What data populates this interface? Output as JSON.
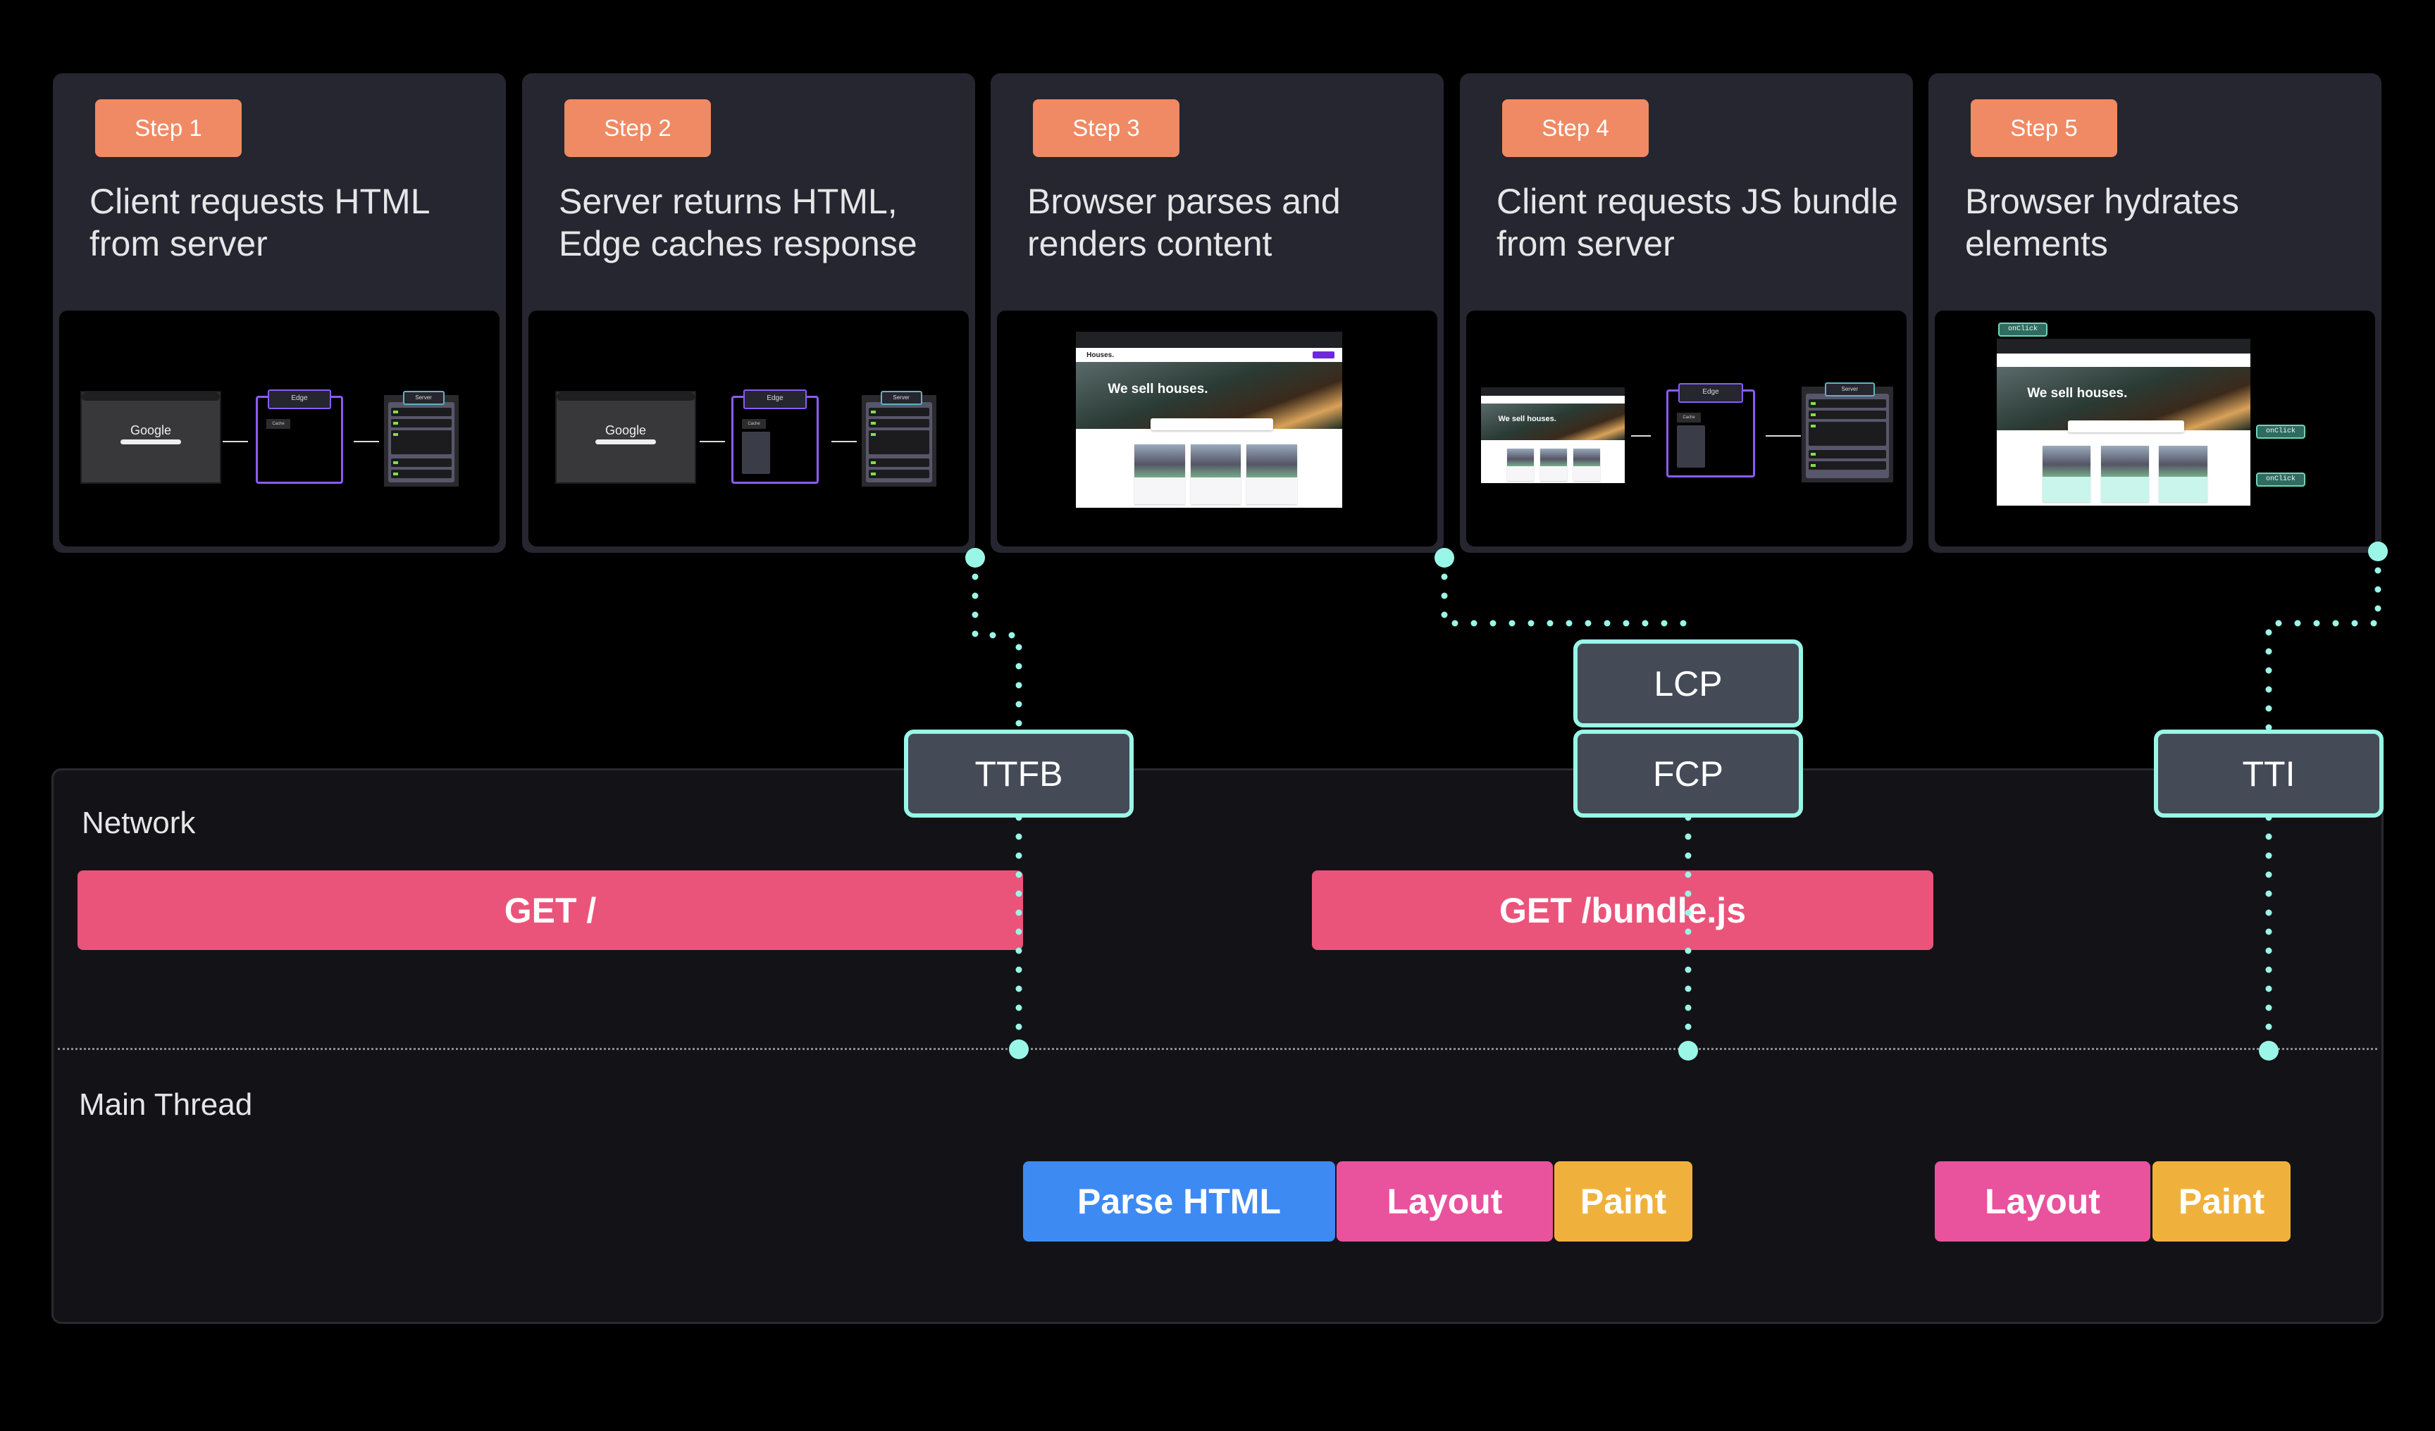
{
  "steps": [
    {
      "badge": "Step 1",
      "title": "Client requests HTML from server",
      "illustration": "browser-edge-server",
      "arrows": "right",
      "labels": {
        "google": "Google",
        "edge": "Edge",
        "cache": "Cache",
        "server": "Server"
      }
    },
    {
      "badge": "Step 2",
      "title": "Server returns HTML, Edge caches response",
      "illustration": "browser-edge-server",
      "arrows": "left",
      "labels": {
        "google": "Google",
        "edge": "Edge",
        "cache": "Cache",
        "server": "Server"
      }
    },
    {
      "badge": "Step 3",
      "title": "Browser parses and renders content",
      "illustration": "website",
      "labels": {
        "logo": "Houses.",
        "hero": "We sell houses."
      }
    },
    {
      "badge": "Step 4",
      "title": "Client requests JS bundle from server",
      "illustration": "website-edge-server",
      "arrows": "right",
      "labels": {
        "hero": "We sell houses.",
        "edge": "Edge",
        "cache": "Cache",
        "server": "Server"
      }
    },
    {
      "badge": "Step 5",
      "title": "Browser hydrates elements",
      "illustration": "website-hydrated",
      "labels": {
        "hero": "We sell houses.",
        "onclick": "onClick"
      }
    }
  ],
  "metrics": {
    "ttfb": "TTFB",
    "lcp": "LCP",
    "fcp": "FCP",
    "tti": "TTI"
  },
  "timeline": {
    "network_label": "Network",
    "main_thread_label": "Main Thread",
    "network": [
      {
        "label": "GET /",
        "color": "#ea547a"
      },
      {
        "label": "GET /bundle.js",
        "color": "#ea547a"
      }
    ],
    "main_thread": [
      {
        "label": "Parse HTML",
        "color": "#3e8af3"
      },
      {
        "label": "Layout",
        "color": "#e9529d"
      },
      {
        "label": "Paint",
        "color": "#f0b13c"
      },
      {
        "label": "Layout",
        "color": "#e9529d"
      },
      {
        "label": "Paint",
        "color": "#f0b13c"
      }
    ]
  },
  "colors": {
    "badge": "#ef8a64",
    "metric_border": "#9af7e7",
    "card": "#25262f",
    "edge": "#8b5cf6"
  }
}
